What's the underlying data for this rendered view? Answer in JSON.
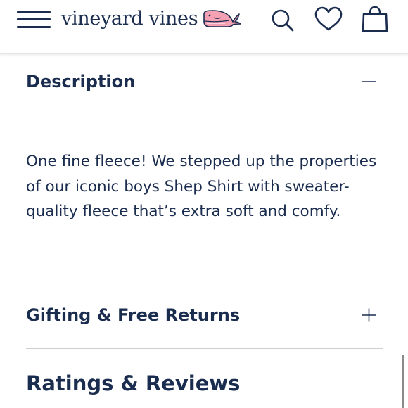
{
  "header": {
    "logo_text": "vineyard vines",
    "menu_icon": "hamburger-menu-icon",
    "logo_icon": "whale-logo-icon",
    "search_icon": "search-icon",
    "wishlist_icon": "heart-icon",
    "bag_icon": "shopping-bag-icon"
  },
  "sections": {
    "description": {
      "title": "Description",
      "state": "expanded",
      "toggle_icon": "minus-icon",
      "body": "One fine fleece! We stepped up the properties of our iconic boys Shep Shirt with sweater-quality fleece that’s extra soft and comfy."
    },
    "gifting": {
      "title": "Gifting & Free Returns",
      "state": "collapsed",
      "toggle_icon": "plus-icon"
    },
    "ratings": {
      "title": "Ratings & Reviews"
    }
  },
  "colors": {
    "navy": "#1b2d4f",
    "whale_pink": "#f4a1b4",
    "divider": "#cfcfcf"
  }
}
